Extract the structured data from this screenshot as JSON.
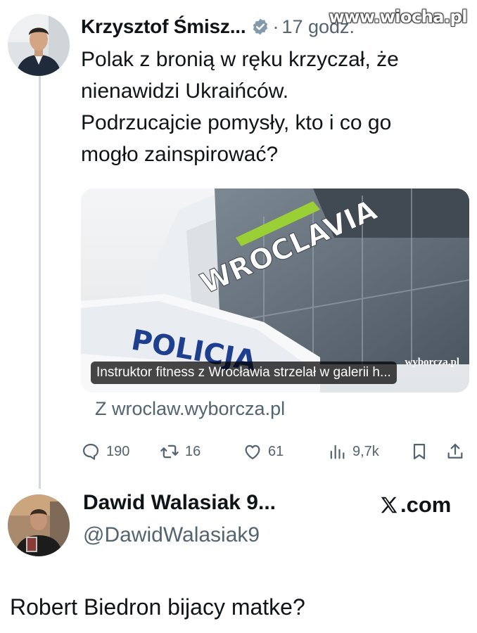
{
  "watermark": "www.wiocha.pl",
  "tweet1": {
    "author_name": "Krzysztof Śmisz...",
    "separator": "·",
    "time": "17 godz.",
    "verified_icon": "verified-badge-icon",
    "text_lines": [
      "Polak z bronią w ręku krzyczał, że",
      "nienawidzi Ukraińców.",
      "Podrzucajcie pomysły, kto i co go",
      "mogło zainspirować?"
    ],
    "card": {
      "caption": "Instruktor fitness z Wrocławia strzelał w galerii h...",
      "logo_text": "wyborcza.pl",
      "building_sign": "WROCLAVIA",
      "banner_text": "POLICJA",
      "source": "Z wroclaw.wyborcza.pl"
    },
    "actions": {
      "replies": "190",
      "reposts": "16",
      "likes": "61",
      "views": "9,7k"
    }
  },
  "tweet2": {
    "author_name": "Dawid Walasiak 9...",
    "handle": "@DawidWalasiak9",
    "brand": ".com"
  },
  "caption": "Robert Biedron bijacy matke?",
  "colors": {
    "text": "#0f1419",
    "secondary": "#536471",
    "verified": "#829aab",
    "thread_line": "#cfd9de"
  }
}
